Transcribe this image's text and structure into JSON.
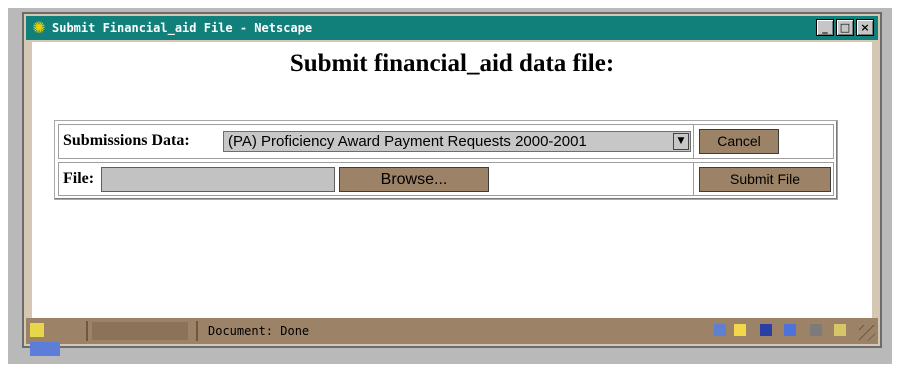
{
  "window": {
    "title": "Submit Financial_aid File - Netscape",
    "buttons": {
      "minimize": "_",
      "maximize": "□",
      "close": "×"
    },
    "app_icon": "netscape-icon"
  },
  "page": {
    "heading": "Submit financial_aid data file:"
  },
  "form": {
    "submissions_label": "Submissions Data:",
    "submissions_selected": "(PA) Proficiency Award Payment Requests 2000-2001",
    "cancel_label": "Cancel",
    "file_label": "File:",
    "file_value": "",
    "browse_label": "Browse...",
    "submit_label": "Submit File"
  },
  "statusbar": {
    "text": "Document: Done",
    "icons": [
      "security-key-icon",
      "network-icon",
      "component-icons"
    ]
  },
  "colors": {
    "titlebar": "#11807b",
    "button_bg": "#9c8266",
    "statusbar": "#9c8266"
  }
}
